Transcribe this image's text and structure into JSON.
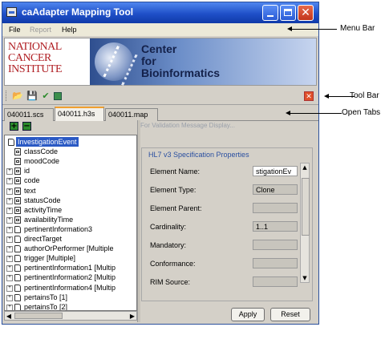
{
  "window": {
    "title": "caAdapter Mapping Tool"
  },
  "menu": [
    "File",
    "Report",
    "Help"
  ],
  "banner": {
    "nci": [
      "NATIONAL",
      "CANCER",
      "INSTITUTE"
    ],
    "cbiit": [
      "Center",
      "for",
      "Bioinformatics"
    ]
  },
  "toolbar": {
    "icons": [
      "open-icon",
      "save-icon",
      "validate-icon",
      "grid-icon",
      "close-panel-icon"
    ]
  },
  "tabs": [
    {
      "label": "040011.scs",
      "active": false
    },
    {
      "label": "040011.h3s",
      "active": true
    },
    {
      "label": "040011.map",
      "active": false
    }
  ],
  "tree": [
    {
      "label": "InvestigationEvent",
      "level": 0,
      "icon": "folder",
      "selected": true,
      "expandable": false
    },
    {
      "label": "classCode",
      "level": 1,
      "icon": "attr",
      "expandable": false
    },
    {
      "label": "moodCode",
      "level": 1,
      "icon": "attr",
      "expandable": false
    },
    {
      "label": "id",
      "level": 1,
      "icon": "attr",
      "expandable": true
    },
    {
      "label": "code",
      "level": 1,
      "icon": "attr",
      "expandable": true
    },
    {
      "label": "text",
      "level": 1,
      "icon": "attr",
      "expandable": true
    },
    {
      "label": "statusCode",
      "level": 1,
      "icon": "attr",
      "expandable": true
    },
    {
      "label": "activityTime",
      "level": 1,
      "icon": "attr",
      "expandable": true
    },
    {
      "label": "availabilityTime",
      "level": 1,
      "icon": "attr",
      "expandable": true
    },
    {
      "label": "pertinentInformation3",
      "level": 1,
      "icon": "folder",
      "expandable": true
    },
    {
      "label": "directTarget",
      "level": 1,
      "icon": "folder",
      "expandable": true
    },
    {
      "label": "authorOrPerformer  [Multiple",
      "level": 1,
      "icon": "folder",
      "expandable": true
    },
    {
      "label": "trigger  [Multiple]",
      "level": 1,
      "icon": "folder",
      "expandable": true
    },
    {
      "label": "pertinentInformation1  [Multip",
      "level": 1,
      "icon": "folder",
      "expandable": true
    },
    {
      "label": "pertinentInformation2  [Multip",
      "level": 1,
      "icon": "folder",
      "expandable": true
    },
    {
      "label": "pertinentInformation4  [Multip",
      "level": 1,
      "icon": "folder",
      "expandable": true
    },
    {
      "label": "pertainsTo  [1]",
      "level": 1,
      "icon": "folder",
      "expandable": true
    },
    {
      "label": "pertainsTo  [2]",
      "level": 1,
      "icon": "folder",
      "expandable": true
    }
  ],
  "validation": {
    "placeholder": "For Validation Message Display..."
  },
  "properties": {
    "title": "HL7 v3 Specification Properties",
    "rows": [
      {
        "label": "Element Name:",
        "value": "stigationEv"
      },
      {
        "label": "Element Type:",
        "value": "Clone"
      },
      {
        "label": "Element Parent:",
        "value": ""
      },
      {
        "label": "Cardinality:",
        "value": "1..1"
      },
      {
        "label": "Mandatory:",
        "value": ""
      },
      {
        "label": "Conformance:",
        "value": ""
      },
      {
        "label": "RIM Source:",
        "value": ""
      }
    ]
  },
  "buttons": {
    "apply": "Apply",
    "reset": "Reset"
  },
  "callouts": {
    "menu_bar": "Menu Bar",
    "tool_bar": "Tool Bar",
    "open_tabs": "Open Tabs"
  }
}
